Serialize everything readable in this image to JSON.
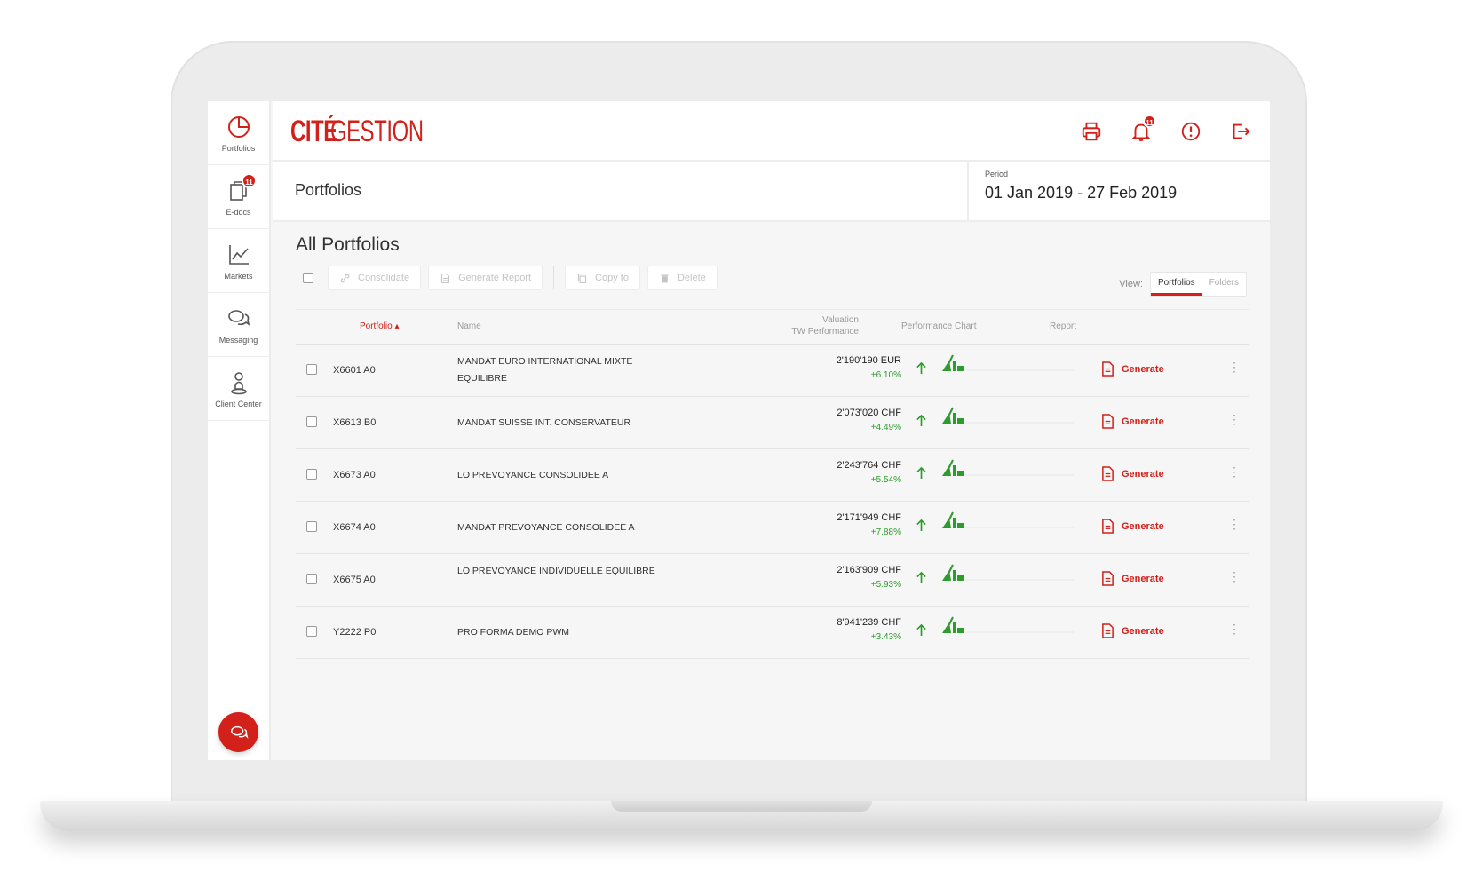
{
  "brand": {
    "accent": "#d2201a",
    "positive": "#2e9b2e",
    "logo_part1": "CITÉ",
    "logo_part2": "GESTION"
  },
  "sidebar": {
    "items": [
      {
        "label": "Portfolios",
        "icon": "pie-chart-icon"
      },
      {
        "label": "E-docs",
        "icon": "documents-icon",
        "badge": "11"
      },
      {
        "label": "Markets",
        "icon": "line-chart-icon"
      },
      {
        "label": "Messaging",
        "icon": "chat-bubbles-icon"
      },
      {
        "label": "Client Center",
        "icon": "client-center-icon"
      }
    ],
    "chat_icon": "chat-icon"
  },
  "topbar": {
    "icons": [
      "printer-icon",
      "bell-icon",
      "alert-icon",
      "logout-icon"
    ],
    "notifications_badge": "11"
  },
  "header": {
    "title": "Portfolios",
    "period_label": "Period",
    "period_value": "01 Jan 2019 - 27 Feb 2019"
  },
  "main": {
    "section_title": "All Portfolios",
    "toolbar": {
      "consolidate": "Consolidate",
      "generate_report": "Generate Report",
      "copy_to": "Copy to",
      "delete": "Delete"
    },
    "view": {
      "label": "View:",
      "options": [
        "Portfolios",
        "Folders"
      ],
      "selected": "Portfolios"
    },
    "table": {
      "columns": {
        "portfolio": "Portfolio",
        "name": "Name",
        "valuation": "Valuation",
        "tw_performance": "TW Performance",
        "performance_chart": "Performance Chart",
        "report": "Report"
      },
      "rows": [
        {
          "code": "X6601 A0",
          "name": "MANDAT EURO INTERNATIONAL MIXTE EQUILIBRE",
          "valuation": "2'190'190 EUR",
          "performance": "+6.10%",
          "report": "Generate"
        },
        {
          "code": "X6613 B0",
          "name": "MANDAT SUISSE INT. CONSERVATEUR",
          "valuation": "2'073'020 CHF",
          "performance": "+4.49%",
          "report": "Generate"
        },
        {
          "code": "X6673 A0",
          "name": "LO PREVOYANCE CONSOLIDEE A",
          "valuation": "2'243'764 CHF",
          "performance": "+5.54%",
          "report": "Generate"
        },
        {
          "code": "X6674 A0",
          "name": "MANDAT PREVOYANCE CONSOLIDEE A",
          "valuation": "2'171'949 CHF",
          "performance": "+7.88%",
          "report": "Generate"
        },
        {
          "code": "X6675 A0",
          "name": "LO PREVOYANCE INDIVIDUELLE EQUILIBRE",
          "valuation": "2'163'909 CHF",
          "performance": "+5.93%",
          "report": "Generate"
        },
        {
          "code": "Y2222 P0",
          "name": "PRO FORMA DEMO PWM",
          "valuation": "8'941'239 CHF",
          "performance": "+3.43%",
          "report": "Generate"
        }
      ]
    }
  }
}
